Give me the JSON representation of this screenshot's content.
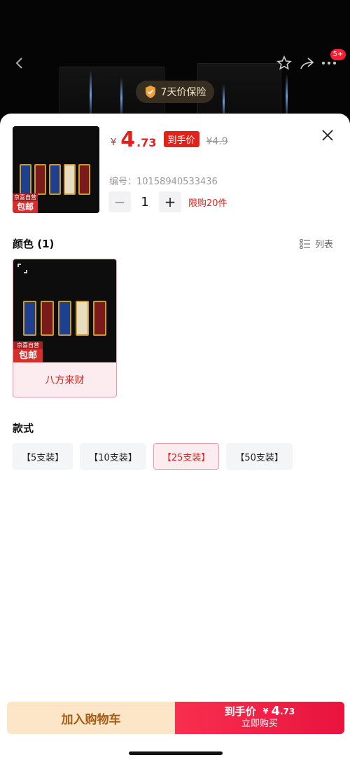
{
  "header": {
    "badge_count": "5+",
    "guarantee_text": "7天价保险",
    "icons": {
      "back": "chevron-left-icon",
      "favorite": "star-icon",
      "share": "share-icon",
      "more": "more-icon"
    }
  },
  "product": {
    "yen": "¥",
    "price_int": "4",
    "price_dec": ".73",
    "final_tag": "到手价",
    "old_price": "¥4.9",
    "sku": "编号：10158940533436",
    "quantity": "1",
    "limit_text": "限购20件",
    "badge_line1": "京喜自营",
    "badge_line2": "包邮"
  },
  "color_section": {
    "title": "颜色 (1)",
    "toggle_label": "列表",
    "items": [
      {
        "name": "八方来财",
        "badge_line1": "京喜自营",
        "badge_line2": "包邮"
      }
    ]
  },
  "style_section": {
    "title": "款式",
    "options": [
      {
        "label": "【5支装】",
        "selected": false
      },
      {
        "label": "【10支装】",
        "selected": false
      },
      {
        "label": "【25支装】",
        "selected": true
      },
      {
        "label": "【50支装】",
        "selected": false
      }
    ]
  },
  "bottom_bar": {
    "cart_label": "加入购物车",
    "buy_prefix": "到手价",
    "buy_yen": "¥",
    "buy_int": "4",
    "buy_dec": ".73",
    "buy_label": "立即购买"
  },
  "colors": {
    "accent_red": "#e2231a",
    "cart_bg": "#fde6c8",
    "buy_bg": "#f92f4f"
  }
}
